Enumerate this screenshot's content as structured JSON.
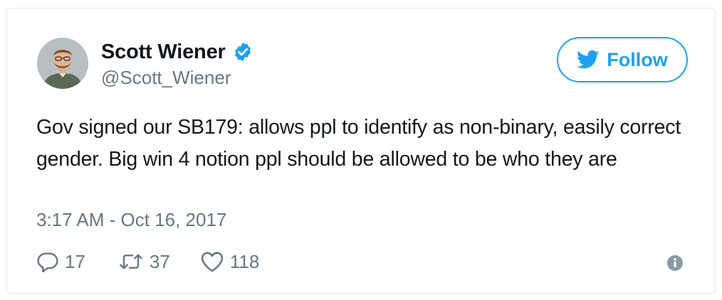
{
  "author": {
    "display_name": "Scott Wiener",
    "handle": "@Scott_Wiener",
    "verified": true
  },
  "follow_button": {
    "label": "Follow",
    "icon": "twitter-bird-icon"
  },
  "tweet": {
    "text": "Gov signed our SB179: allows ppl to identify as non-binary, easily correct gender. Big win 4 notion ppl should be allowed to be who they are",
    "timestamp": "3:17 AM - Oct 16, 2017"
  },
  "actions": {
    "replies": "17",
    "retweets": "37",
    "likes": "118"
  },
  "colors": {
    "accent": "#1da1f2",
    "text": "#14171a",
    "muted": "#657786",
    "border": "#e1e8ed"
  }
}
